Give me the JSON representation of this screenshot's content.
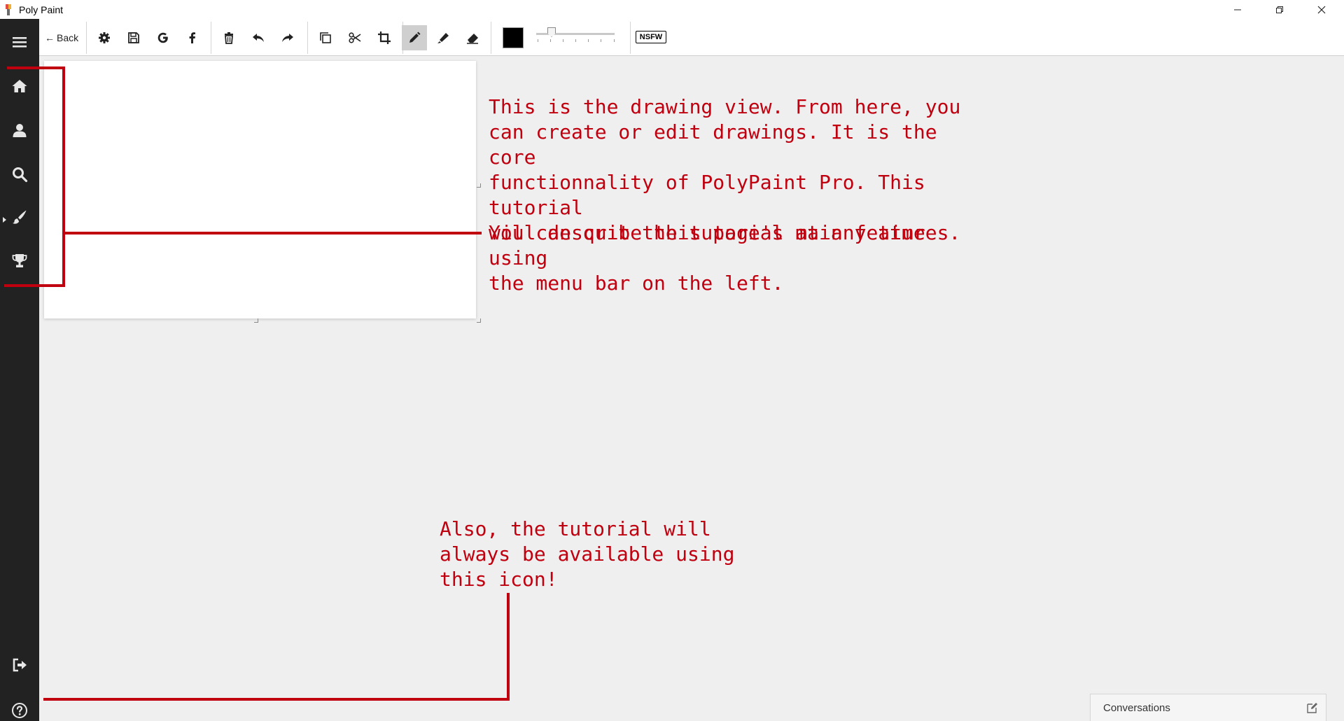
{
  "window": {
    "title": "Poly Paint",
    "controls": {
      "minimize": "—",
      "maximize": "❐",
      "close": "✕"
    }
  },
  "toolbar": {
    "back_label": "Back",
    "back_arrow": "←",
    "tools": [
      "settings-icon",
      "save-icon",
      "google-icon",
      "facebook-icon",
      "trash-icon",
      "undo-icon",
      "redo-icon",
      "duplicate-icon",
      "scissors-icon",
      "crop-icon",
      "pencil-icon",
      "marker-icon",
      "eraser-icon"
    ],
    "active_tool": "pencil-icon",
    "stroke_color": "#000000",
    "nsfw_label": "NSFW"
  },
  "sidebar": {
    "items": [
      "menu-icon",
      "home-icon",
      "user-icon",
      "search-icon",
      "brush-icon",
      "trophy-icon"
    ],
    "bottom_items": [
      "logout-icon",
      "help-icon"
    ]
  },
  "tutorial": {
    "text1": "This is the drawing view. From here, you\ncan create or edit drawings. It is the core\nfunctionnality of PolyPaint Pro. This tutorial\nwill describe this page's main features.",
    "text2": "You can quit the tutorial at any time using\nthe menu bar on the left.",
    "text3": "Also, the tutorial will\nalways be available using\nthis icon!",
    "accent_color": "#c0000f"
  },
  "conversations": {
    "label": "Conversations",
    "icon": "edit-icon"
  },
  "colors": {
    "sidebar_bg": "#222222",
    "workspace_bg": "#efefef",
    "canvas_bg": "#ffffff"
  }
}
